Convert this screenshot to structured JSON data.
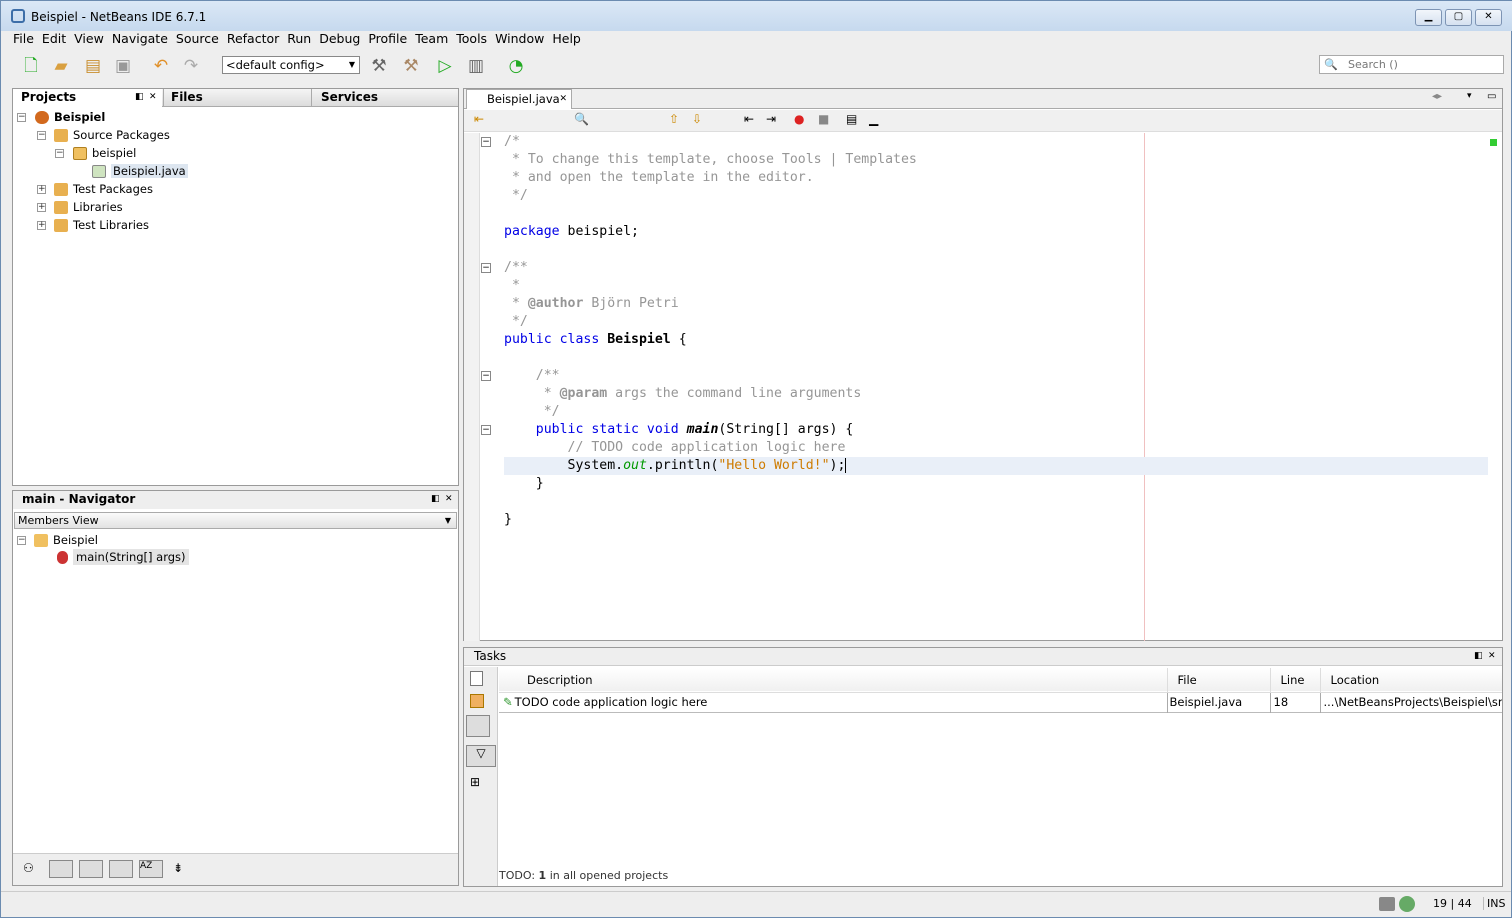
{
  "window": {
    "title": "Beispiel - NetBeans IDE 6.7.1"
  },
  "menu": [
    "File",
    "Edit",
    "View",
    "Navigate",
    "Source",
    "Refactor",
    "Run",
    "Debug",
    "Profile",
    "Team",
    "Tools",
    "Window",
    "Help"
  ],
  "toolbar": {
    "config": "<default config>",
    "search_placeholder": "Search ()"
  },
  "projects": {
    "tabs": [
      "Projects",
      "Files",
      "Services"
    ],
    "tree": [
      {
        "label": "Beispiel",
        "bold": true,
        "icon": "project-icon"
      },
      {
        "label": "Source Packages",
        "icon": "source-packages-icon"
      },
      {
        "label": "beispiel",
        "icon": "package-icon"
      },
      {
        "label": "Beispiel.java",
        "icon": "java-file-icon"
      },
      {
        "label": "Test Packages",
        "icon": "test-packages-icon"
      },
      {
        "label": "Libraries",
        "icon": "libraries-icon"
      },
      {
        "label": "Test Libraries",
        "icon": "test-libraries-icon"
      }
    ]
  },
  "navigator": {
    "title": "main - Navigator",
    "view": "Members View",
    "class": "Beispiel",
    "method": "main(String[] args)"
  },
  "editor": {
    "tab": "Beispiel.java",
    "lines": [
      [
        [
          "/*",
          "c"
        ]
      ],
      [
        [
          " * To change this template, choose Tools | Templates",
          "c"
        ]
      ],
      [
        [
          " * and open the template in the editor.",
          "c"
        ]
      ],
      [
        [
          " */",
          "c"
        ]
      ],
      [],
      [
        [
          "package",
          "k"
        ],
        [
          " beispiel;",
          "n"
        ]
      ],
      [],
      [
        [
          "/**",
          "c"
        ]
      ],
      [
        [
          " *",
          "c"
        ]
      ],
      [
        [
          " * ",
          "c"
        ],
        [
          "@author",
          "t"
        ],
        [
          " Björn Petri",
          "c"
        ]
      ],
      [
        [
          " */",
          "c"
        ]
      ],
      [
        [
          "public class ",
          "k"
        ],
        [
          "Beispiel",
          "b"
        ],
        [
          " {",
          "n"
        ]
      ],
      [],
      [
        [
          "    /**",
          "c"
        ]
      ],
      [
        [
          "     * ",
          "c"
        ],
        [
          "@param",
          "t"
        ],
        [
          " args the command line arguments",
          "c"
        ]
      ],
      [
        [
          "     */",
          "c"
        ]
      ],
      [
        [
          "    public static void ",
          "k"
        ],
        [
          "main",
          "bi"
        ],
        [
          "(String[] args) {",
          "n"
        ]
      ],
      [
        [
          "        // TODO code application logic here",
          "c"
        ]
      ],
      [
        [
          "        System.",
          "n"
        ],
        [
          "out",
          "f"
        ],
        [
          ".println(",
          "n"
        ],
        [
          "\"Hello World!\"",
          "s"
        ],
        [
          ");",
          "n"
        ]
      ],
      [
        [
          "    }",
          "n"
        ]
      ],
      [],
      [
        [
          "}",
          "n"
        ]
      ]
    ]
  },
  "tasks": {
    "title": "Tasks",
    "columns": [
      "Description",
      "File",
      "Line",
      "Location"
    ],
    "rows": [
      {
        "description": "TODO code application logic here",
        "file": "Beispiel.java",
        "line": "18",
        "location": "...\\NetBeansProjects\\Beispiel\\src\\beis"
      }
    ],
    "footer_bold": "TODO:",
    "footer_count": "1",
    "footer_rest": "in all opened projects"
  },
  "status": {
    "position": "19 | 44",
    "mode": "INS"
  },
  "colors": {
    "keyword": "#0000e6",
    "comment": "#969696",
    "string": "#ce7b00",
    "field": "#009900",
    "current_line": "#e9eff8"
  }
}
